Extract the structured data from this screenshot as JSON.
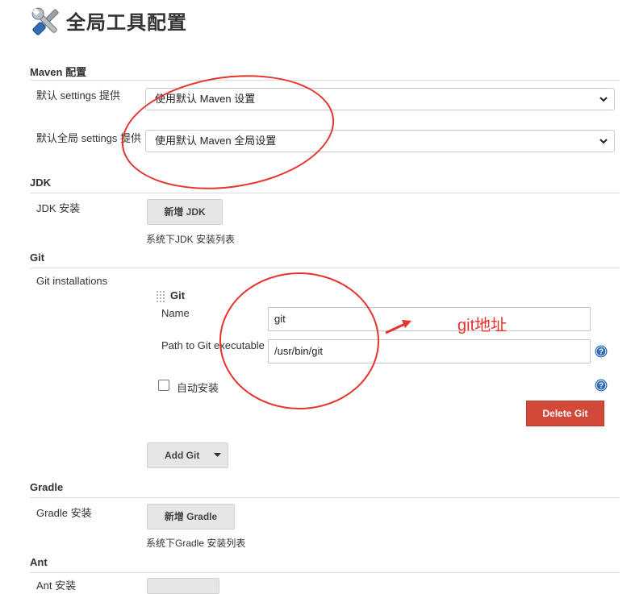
{
  "page": {
    "title": "全局工具配置",
    "icon": "wrench-screwdriver-icon"
  },
  "maven": {
    "section_title": "Maven 配置",
    "settings_label": "默认 settings 提供",
    "settings_value": "使用默认 Maven 设置",
    "global_settings_label": "默认全局 settings 提供",
    "global_settings_value": "使用默认 Maven 全局设置"
  },
  "jdk": {
    "section_title": "JDK",
    "install_label": "JDK 安装",
    "add_button": "新增 JDK",
    "hint": "系统下JDK 安装列表"
  },
  "git": {
    "section_title": "Git",
    "installations_label": "Git installations",
    "item_title": "Git",
    "name_label": "Name",
    "name_value": "git",
    "path_label": "Path to Git executable",
    "path_value": "/usr/bin/git",
    "auto_install_label": "自动安装",
    "auto_install_checked": false,
    "delete_button": "Delete Git",
    "add_button": "Add Git"
  },
  "gradle": {
    "section_title": "Gradle",
    "install_label": "Gradle 安装",
    "add_button": "新增 Gradle",
    "hint": "系统下Gradle 安装列表"
  },
  "ant": {
    "section_title": "Ant",
    "install_label": "Ant 安装"
  },
  "annotation": {
    "text": "git地址",
    "color": "#e8332a"
  },
  "colors": {
    "delete_button": "#d24939",
    "help_icon": "#2f6db5",
    "annotation": "#e8332a"
  }
}
